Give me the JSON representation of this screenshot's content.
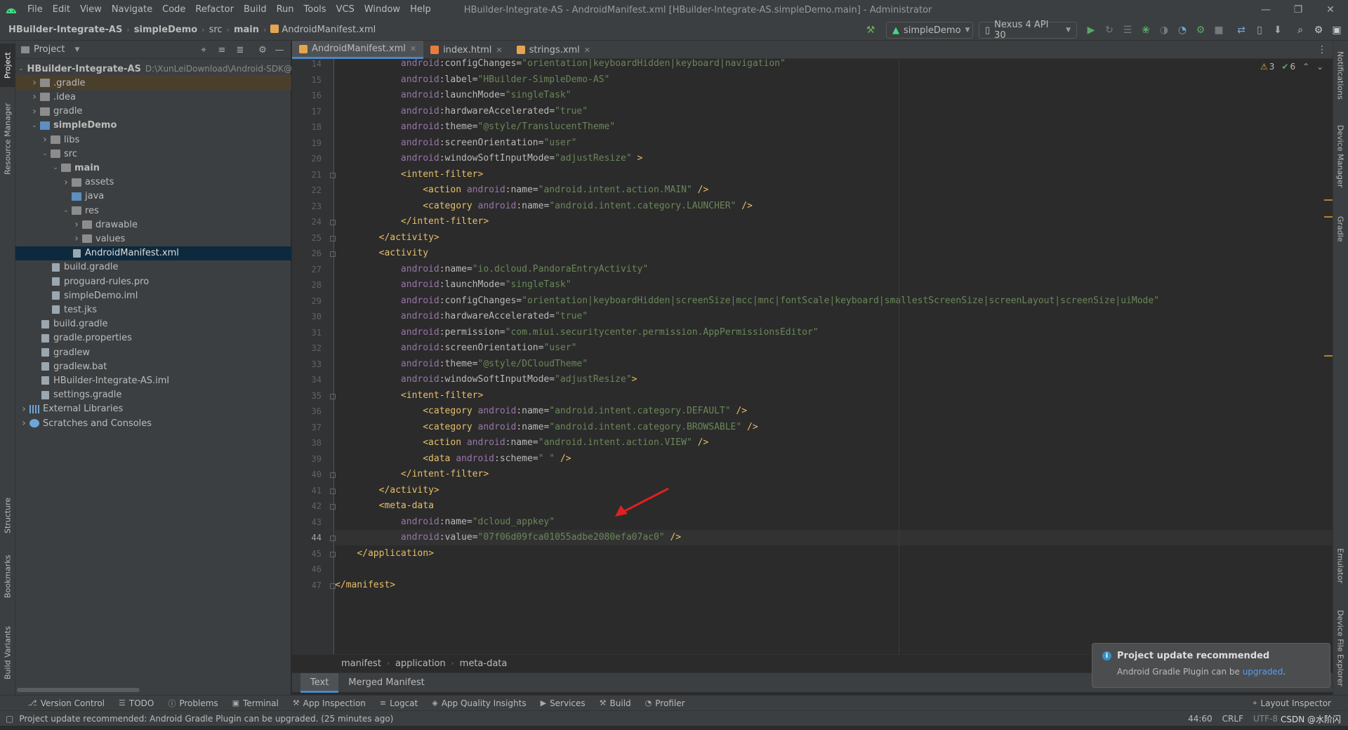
{
  "window": {
    "title": "HBuilder-Integrate-AS - AndroidManifest.xml [HBuilder-Integrate-AS.simpleDemo.main] - Administrator",
    "menu": [
      "File",
      "Edit",
      "View",
      "Navigate",
      "Code",
      "Refactor",
      "Build",
      "Run",
      "Tools",
      "VCS",
      "Window",
      "Help"
    ],
    "controls": {
      "minimize": "—",
      "restore": "❐",
      "close": "✕"
    }
  },
  "nav": {
    "crumbs": [
      "HBuilder-Integrate-AS",
      "simpleDemo",
      "src",
      "main",
      "AndroidManifest.xml"
    ],
    "run_config": "simpleDemo",
    "device": "Nexus 4 API 30"
  },
  "left_strip": [
    "Project",
    "Resource Manager",
    "Structure",
    "Bookmarks",
    "Build Variants"
  ],
  "right_strip": [
    "Notifications",
    "Device Manager",
    "Gradle",
    "Emulator",
    "Device File Explorer"
  ],
  "project": {
    "title": "Project",
    "tree": [
      {
        "label": "HBuilder-Integrate-AS",
        "extra": "D:\\XunLeiDownload\\Android-SDK@",
        "indent": 0,
        "arrow": "down",
        "icon": "folder-blue",
        "bold": true
      },
      {
        "label": ".gradle",
        "indent": 1,
        "arrow": "right",
        "icon": "folder",
        "highlight": true
      },
      {
        "label": ".idea",
        "indent": 1,
        "arrow": "right",
        "icon": "folder"
      },
      {
        "label": "gradle",
        "indent": 1,
        "arrow": "right",
        "icon": "folder"
      },
      {
        "label": "simpleDemo",
        "indent": 1,
        "arrow": "down",
        "icon": "folder-blue",
        "bold": true
      },
      {
        "label": "libs",
        "indent": 2,
        "arrow": "right",
        "icon": "folder"
      },
      {
        "label": "src",
        "indent": 2,
        "arrow": "down",
        "icon": "folder"
      },
      {
        "label": "main",
        "indent": 3,
        "arrow": "down",
        "icon": "folder",
        "bold": true
      },
      {
        "label": "assets",
        "indent": 4,
        "arrow": "right",
        "icon": "folder"
      },
      {
        "label": "java",
        "indent": 4,
        "arrow": "",
        "icon": "folder-blue"
      },
      {
        "label": "res",
        "indent": 4,
        "arrow": "down",
        "icon": "folder"
      },
      {
        "label": "drawable",
        "indent": 5,
        "arrow": "right",
        "icon": "folder"
      },
      {
        "label": "values",
        "indent": 5,
        "arrow": "right",
        "icon": "folder"
      },
      {
        "label": "AndroidManifest.xml",
        "indent": 4,
        "arrow": "",
        "icon": "file",
        "selected": true
      },
      {
        "label": "build.gradle",
        "indent": 2,
        "arrow": "",
        "icon": "file"
      },
      {
        "label": "proguard-rules.pro",
        "indent": 2,
        "arrow": "",
        "icon": "file"
      },
      {
        "label": "simpleDemo.iml",
        "indent": 2,
        "arrow": "",
        "icon": "file"
      },
      {
        "label": "test.jks",
        "indent": 2,
        "arrow": "",
        "icon": "file"
      },
      {
        "label": "build.gradle",
        "indent": 1,
        "arrow": "",
        "icon": "file"
      },
      {
        "label": "gradle.properties",
        "indent": 1,
        "arrow": "",
        "icon": "file"
      },
      {
        "label": "gradlew",
        "indent": 1,
        "arrow": "",
        "icon": "file"
      },
      {
        "label": "gradlew.bat",
        "indent": 1,
        "arrow": "",
        "icon": "file"
      },
      {
        "label": "HBuilder-Integrate-AS.iml",
        "indent": 1,
        "arrow": "",
        "icon": "file"
      },
      {
        "label": "settings.gradle",
        "indent": 1,
        "arrow": "",
        "icon": "file"
      },
      {
        "label": "External Libraries",
        "indent": 0,
        "arrow": "right",
        "icon": "lib"
      },
      {
        "label": "Scratches and Consoles",
        "indent": 0,
        "arrow": "right",
        "icon": "scratch"
      }
    ]
  },
  "tabs": [
    {
      "label": "AndroidManifest.xml",
      "active": true,
      "icon": "xml"
    },
    {
      "label": "index.html",
      "active": false,
      "icon": "html"
    },
    {
      "label": "strings.xml",
      "active": false,
      "icon": "xml"
    }
  ],
  "inspections": {
    "warnings": "3",
    "ok": "6"
  },
  "editor": {
    "current_line": 44,
    "lines": [
      {
        "n": 14,
        "code": "            android:configChanges=\"orientation|keyboardHidden|keyboard|navigation\""
      },
      {
        "n": 15,
        "code": "            android:label=\"HBuilder-SimpleDemo-AS\""
      },
      {
        "n": 16,
        "code": "            android:launchMode=\"singleTask\""
      },
      {
        "n": 17,
        "code": "            android:hardwareAccelerated=\"true\""
      },
      {
        "n": 18,
        "code": "            android:theme=\"@style/TranslucentTheme\""
      },
      {
        "n": 19,
        "code": "            android:screenOrientation=\"user\""
      },
      {
        "n": 20,
        "code": "            android:windowSoftInputMode=\"adjustResize\" >"
      },
      {
        "n": 21,
        "code": "            <intent-filter>"
      },
      {
        "n": 22,
        "code": "                <action android:name=\"android.intent.action.MAIN\" />"
      },
      {
        "n": 23,
        "code": "                <category android:name=\"android.intent.category.LAUNCHER\" />"
      },
      {
        "n": 24,
        "code": "            </intent-filter>"
      },
      {
        "n": 25,
        "code": "        </activity>"
      },
      {
        "n": 26,
        "code": "        <activity"
      },
      {
        "n": 27,
        "code": "            android:name=\"io.dcloud.PandoraEntryActivity\""
      },
      {
        "n": 28,
        "code": "            android:launchMode=\"singleTask\""
      },
      {
        "n": 29,
        "code": "            android:configChanges=\"orientation|keyboardHidden|screenSize|mcc|mnc|fontScale|keyboard|smallestScreenSize|screenLayout|screenSize|uiMode\""
      },
      {
        "n": 30,
        "code": "            android:hardwareAccelerated=\"true\""
      },
      {
        "n": 31,
        "code": "            android:permission=\"com.miui.securitycenter.permission.AppPermissionsEditor\""
      },
      {
        "n": 32,
        "code": "            android:screenOrientation=\"user\""
      },
      {
        "n": 33,
        "code": "            android:theme=\"@style/DCloudTheme\""
      },
      {
        "n": 34,
        "code": "            android:windowSoftInputMode=\"adjustResize\">"
      },
      {
        "n": 35,
        "code": "            <intent-filter>"
      },
      {
        "n": 36,
        "code": "                <category android:name=\"android.intent.category.DEFAULT\" />"
      },
      {
        "n": 37,
        "code": "                <category android:name=\"android.intent.category.BROWSABLE\" />"
      },
      {
        "n": 38,
        "code": "                <action android:name=\"android.intent.action.VIEW\" />"
      },
      {
        "n": 39,
        "code": "                <data android:scheme=\" \" />"
      },
      {
        "n": 40,
        "code": "            </intent-filter>"
      },
      {
        "n": 41,
        "code": "        </activity>"
      },
      {
        "n": 42,
        "code": "        <meta-data"
      },
      {
        "n": 43,
        "code": "            android:name=\"dcloud_appkey\""
      },
      {
        "n": 44,
        "code": "            android:value=\"07f06d09fca01055adbe2080efa07ac0\" />"
      },
      {
        "n": 45,
        "code": "    </application>"
      },
      {
        "n": 46,
        "code": ""
      },
      {
        "n": 47,
        "code": "</manifest>"
      }
    ]
  },
  "editor_crumbs": [
    "manifest",
    "application",
    "meta-data"
  ],
  "subtabs": [
    {
      "label": "Text",
      "active": true
    },
    {
      "label": "Merged Manifest",
      "active": false
    }
  ],
  "bottom_tools": [
    {
      "label": "Version Control",
      "icon": "⎇"
    },
    {
      "label": "TODO",
      "icon": "☰"
    },
    {
      "label": "Problems",
      "icon": "ⓘ"
    },
    {
      "label": "Terminal",
      "icon": "▣"
    },
    {
      "label": "App Inspection",
      "icon": "⚒"
    },
    {
      "label": "Logcat",
      "icon": "≡"
    },
    {
      "label": "App Quality Insights",
      "icon": "◈"
    },
    {
      "label": "Services",
      "icon": "▶"
    },
    {
      "label": "Build",
      "icon": "⚒"
    },
    {
      "label": "Profiler",
      "icon": "◔"
    }
  ],
  "layout_inspector": "Layout Inspector",
  "status": {
    "message": "Project update recommended: Android Gradle Plugin can be upgraded. (25 minutes ago)",
    "position": "44:60",
    "line_sep": "CRLF",
    "encoding": "UTF-8",
    "watermark": "CSDN @水阶闪"
  },
  "notification": {
    "title": "Project update recommended",
    "body": "Android Gradle Plugin can be ",
    "link": "upgraded",
    "suffix": "."
  },
  "colors": {
    "accent": "#4a88c7",
    "tag": "#e8bf6a",
    "namespace": "#9876aa",
    "string": "#6a8759",
    "arrow": "#e02020"
  }
}
